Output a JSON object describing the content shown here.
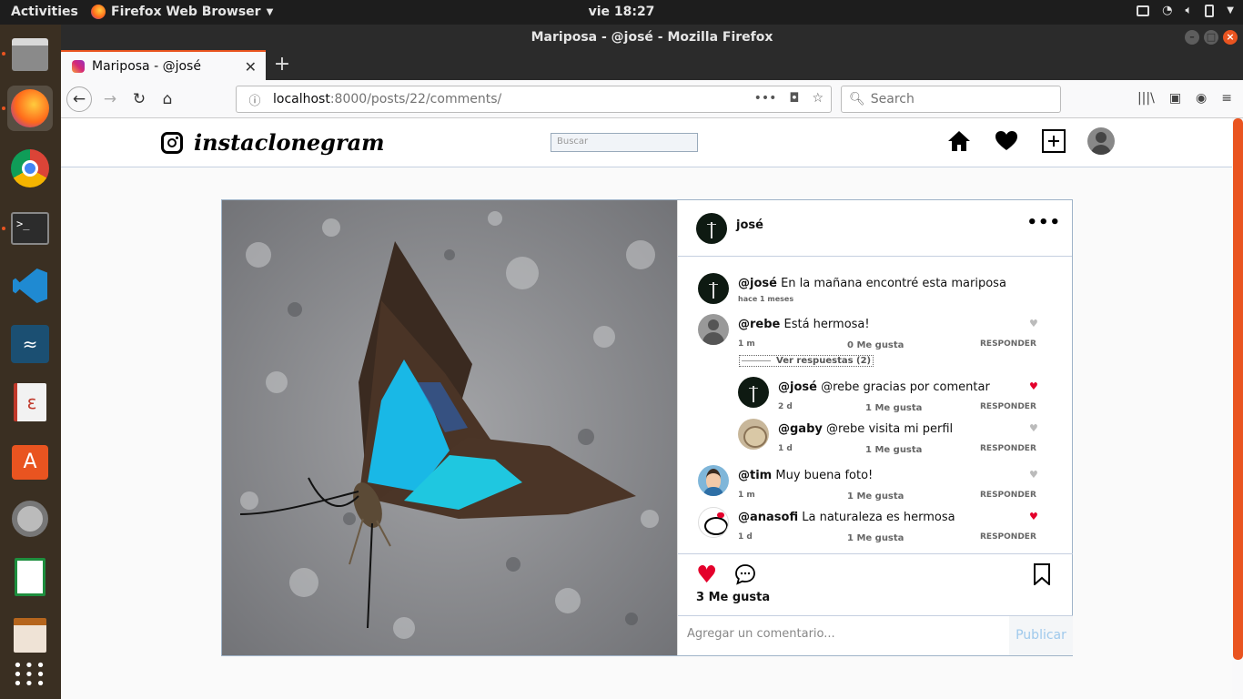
{
  "topbar": {
    "activities": "Activities",
    "app_name": "Firefox Web Browser",
    "clock": "vie 18:27"
  },
  "dock": {
    "items": [
      "Files",
      "Firefox",
      "Chrome",
      "Terminal",
      "VS Code",
      "MySQL Workbench",
      "Document Viewer",
      "Ubuntu Software",
      "Settings",
      "Spreadsheet",
      "Text Editor",
      "Show Applications"
    ]
  },
  "window": {
    "title": "Mariposa - @josé - Mozilla Firefox"
  },
  "tab": {
    "title": "Mariposa - @josé"
  },
  "navbar": {
    "url_host": "localhost",
    "url_path": ":8000/posts/22/comments/",
    "search_placeholder": "Search"
  },
  "ig": {
    "brand": "instaclonegram",
    "search_placeholder": "Buscar"
  },
  "post": {
    "author": "josé",
    "caption": {
      "user": "@josé",
      "text": "En la mañana encontré esta mariposa",
      "time": "hace 1 meses"
    },
    "comments": [
      {
        "user": "@rebe",
        "text": "Está hermosa!",
        "time": "1 m",
        "likes": "0 Me gusta",
        "reply": "RESPONDER",
        "liked": false
      },
      {
        "user": "@tim",
        "text": "Muy buena foto!",
        "time": "1 m",
        "likes": "1 Me gusta",
        "reply": "RESPONDER",
        "liked": false
      },
      {
        "user": "@anasofi",
        "text": "La naturaleza es hermosa",
        "time": "1 d",
        "likes": "1 Me gusta",
        "reply": "RESPONDER",
        "liked": true
      }
    ],
    "view_replies": "Ver respuestas (2)",
    "replies": [
      {
        "user": "@josé",
        "text": "@rebe gracias por comentar",
        "time": "2 d",
        "likes": "1 Me gusta",
        "reply": "RESPONDER",
        "liked": true
      },
      {
        "user": "@gaby",
        "text": "@rebe visita mi perfil",
        "time": "1 d",
        "likes": "1 Me gusta",
        "reply": "RESPONDER",
        "liked": false
      }
    ],
    "likes_label": "3 Me gusta",
    "add_comment_placeholder": "Agregar un comentario...",
    "publish_label": "Publicar"
  },
  "colors": {
    "accent": "#e95420",
    "like_red": "#e4002b",
    "publish_blue": "#9fc9ec",
    "butterfly_blue": "#19b8e6"
  }
}
